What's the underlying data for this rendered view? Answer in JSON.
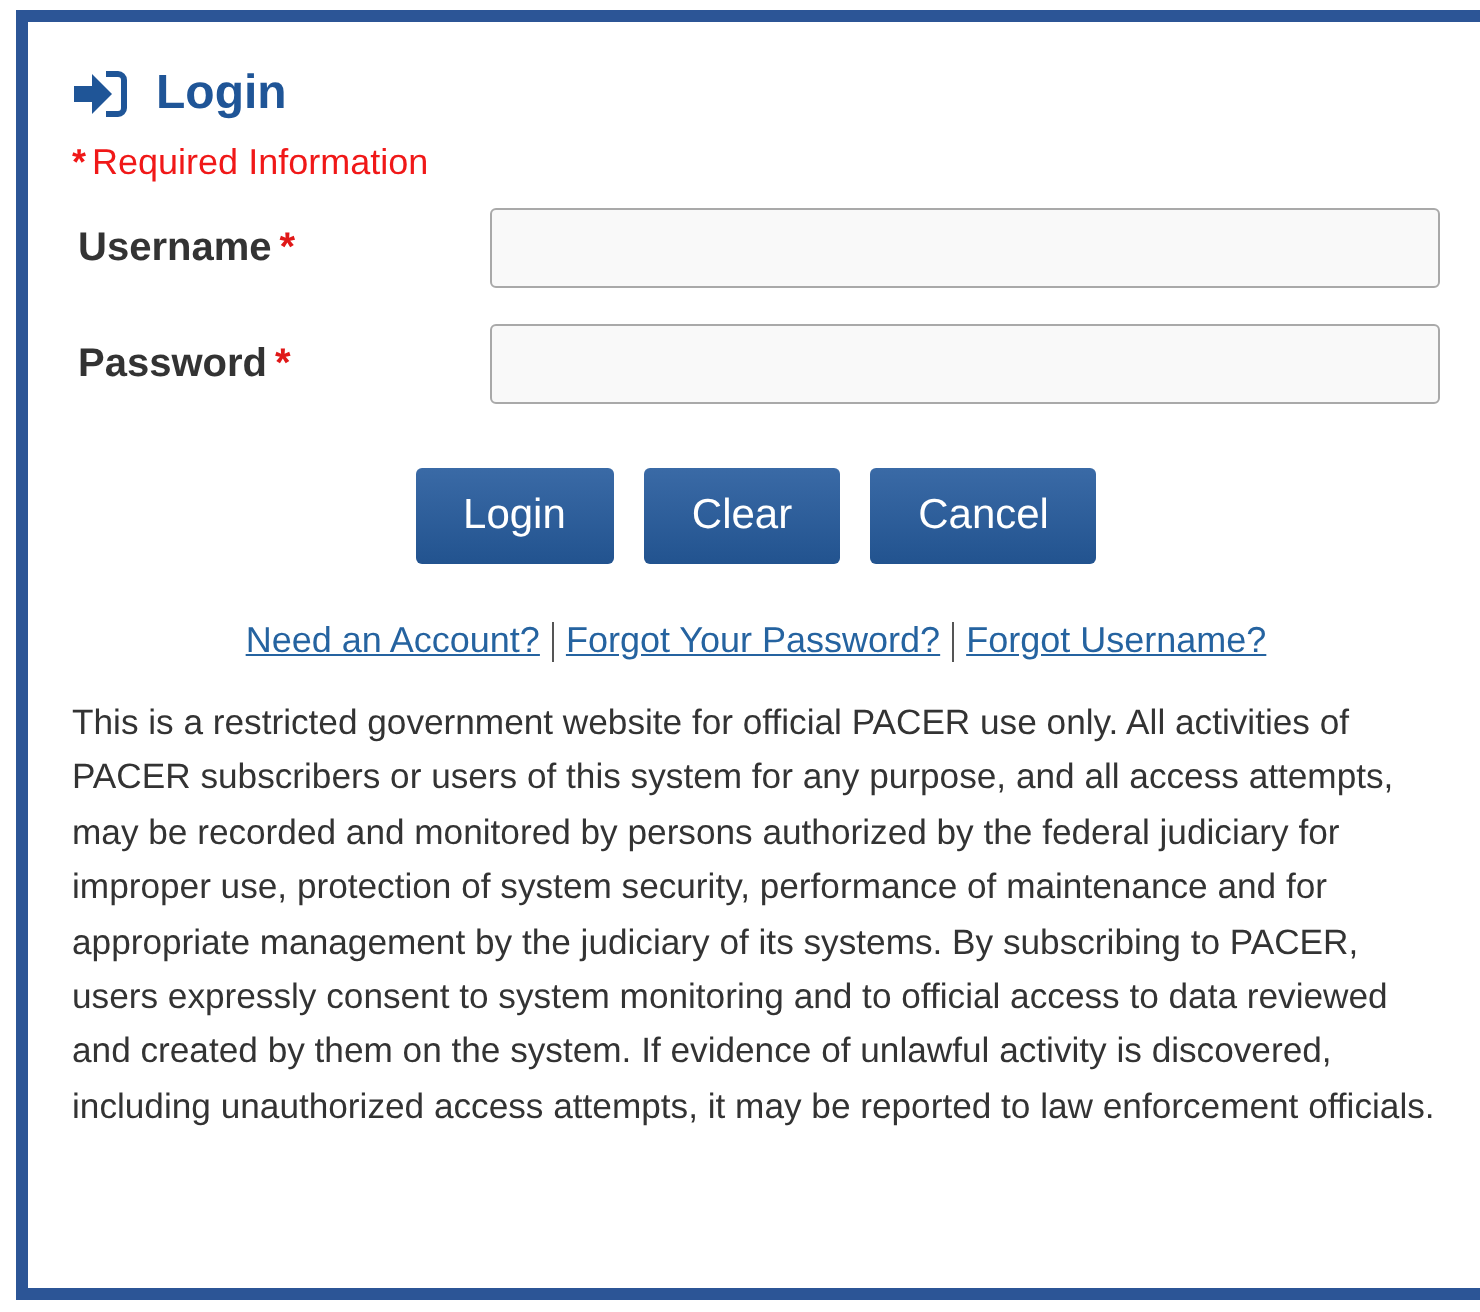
{
  "title": "Login",
  "required_note": {
    "marker": "*",
    "text": "Required Information"
  },
  "fields": [
    {
      "label": "Username",
      "marker": "*"
    },
    {
      "label": "Password",
      "marker": "*"
    }
  ],
  "buttons": [
    "Login",
    "Clear",
    "Cancel"
  ],
  "links": [
    "Need an Account?",
    "Forgot Your Password?",
    "Forgot Username?"
  ],
  "notice": "This is a restricted government website for official PACER use only. All activities of PACER subscribers or users of this system for any purpose, and all access attempts, may be recorded and monitored by persons authorized by the federal judiciary for improper use, protection of system security, performance of maintenance and for appropriate management by the judiciary of its systems. By subscribing to PACER, users expressly consent to system monitoring and to official access to data reviewed and created by them on the system. If evidence of unlawful activity is discovered, including unauthorized access attempts, it may be reported to law enforcement officials."
}
